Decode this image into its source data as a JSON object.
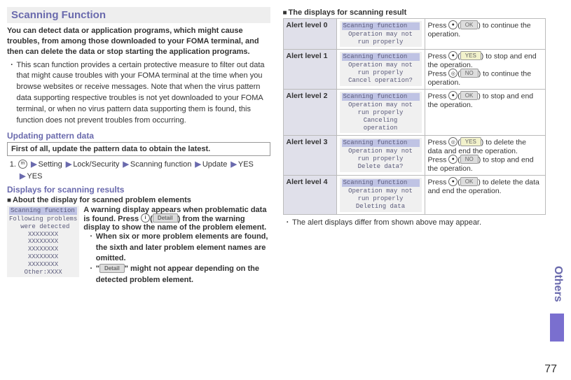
{
  "left": {
    "title": "Scanning Function",
    "intro": "You can detect data or application programs, which might cause troubles, from among those downloaded to your FOMA terminal, and then can delete the data or stop starting the application programs.",
    "bullet": "This scan function provides a certain protective measure to filter out data that might cause troubles with your FOMA terminal at the time when you browse websites or receive messages. Note that when the virus pattern data supporting respective troubles is not yet downloaded to your FOMA terminal, or when no virus pattern data supporting them is found, this function does not prevent troubles from occurring.",
    "updating_head": "Updating pattern data",
    "updating_box": "First of all, update the pattern data to obtain the latest.",
    "step1": {
      "a": "Setting",
      "b": "Lock/Security",
      "c": "Scanning function",
      "d": "Update",
      "e": "YES",
      "f": "YES"
    },
    "results_head": "Displays for scanning results",
    "about_head": "About the display for scanned problem elements",
    "lcd1_hdr": "Scanning function",
    "lcd1_body": "Following problems\n were detected\nXXXXXXXX\nXXXXXXXX\nXXXXXXXX\nXXXXXXXX\nXXXXXXXX\nOther:XXXX",
    "warn_main": "A warning display appears when problematic data is found. Press ",
    "warn_main2": ") from the warning display to show the name of the problem element.",
    "detail_chip": "Detail",
    "warn_b1": "When six or more problem elements are found, the sixth and later problem element names are omitted.",
    "warn_b2a": "\"",
    "warn_b2b": "\" might not appear depending on the detected problem element."
  },
  "right": {
    "head": "The displays for scanning result",
    "hdr": "Scanning function",
    "lvls": [
      {
        "name": "Alert level 0",
        "lcd": "Operation may not\nrun properly"
      },
      {
        "name": "Alert level 1",
        "lcd": "Operation may not\nrun properly\nCancel operation?"
      },
      {
        "name": "Alert level 2",
        "lcd": "Operation may not\nrun properly\nCanceling\noperation"
      },
      {
        "name": "Alert level 3",
        "lcd": "Operation may not\nrun properly\nDelete data?"
      },
      {
        "name": "Alert level 4",
        "lcd": "Operation may not\nrun properly\nDeleting data"
      }
    ],
    "d0": {
      "a": "Press ",
      "b": ") to continue the operation."
    },
    "d1": {
      "a": "Press ",
      "b": ") to stop and end the operation.",
      "c": "Press ",
      "d": ") to continue the operation."
    },
    "d2": {
      "a": "Press ",
      "b": ") to stop and end the operation."
    },
    "d3": {
      "a": "Press ",
      "b": ") to delete the data and end the operation.",
      "c": "Press ",
      "d": ") to stop and end the operation."
    },
    "d4": {
      "a": "Press ",
      "b": ") to delete the data and end the operation."
    },
    "chip_ok": "OK",
    "chip_yes": "YES",
    "chip_no": "NO",
    "note": "The alert displays differ from shown above may appear."
  },
  "side_label": "Others",
  "page": "77"
}
